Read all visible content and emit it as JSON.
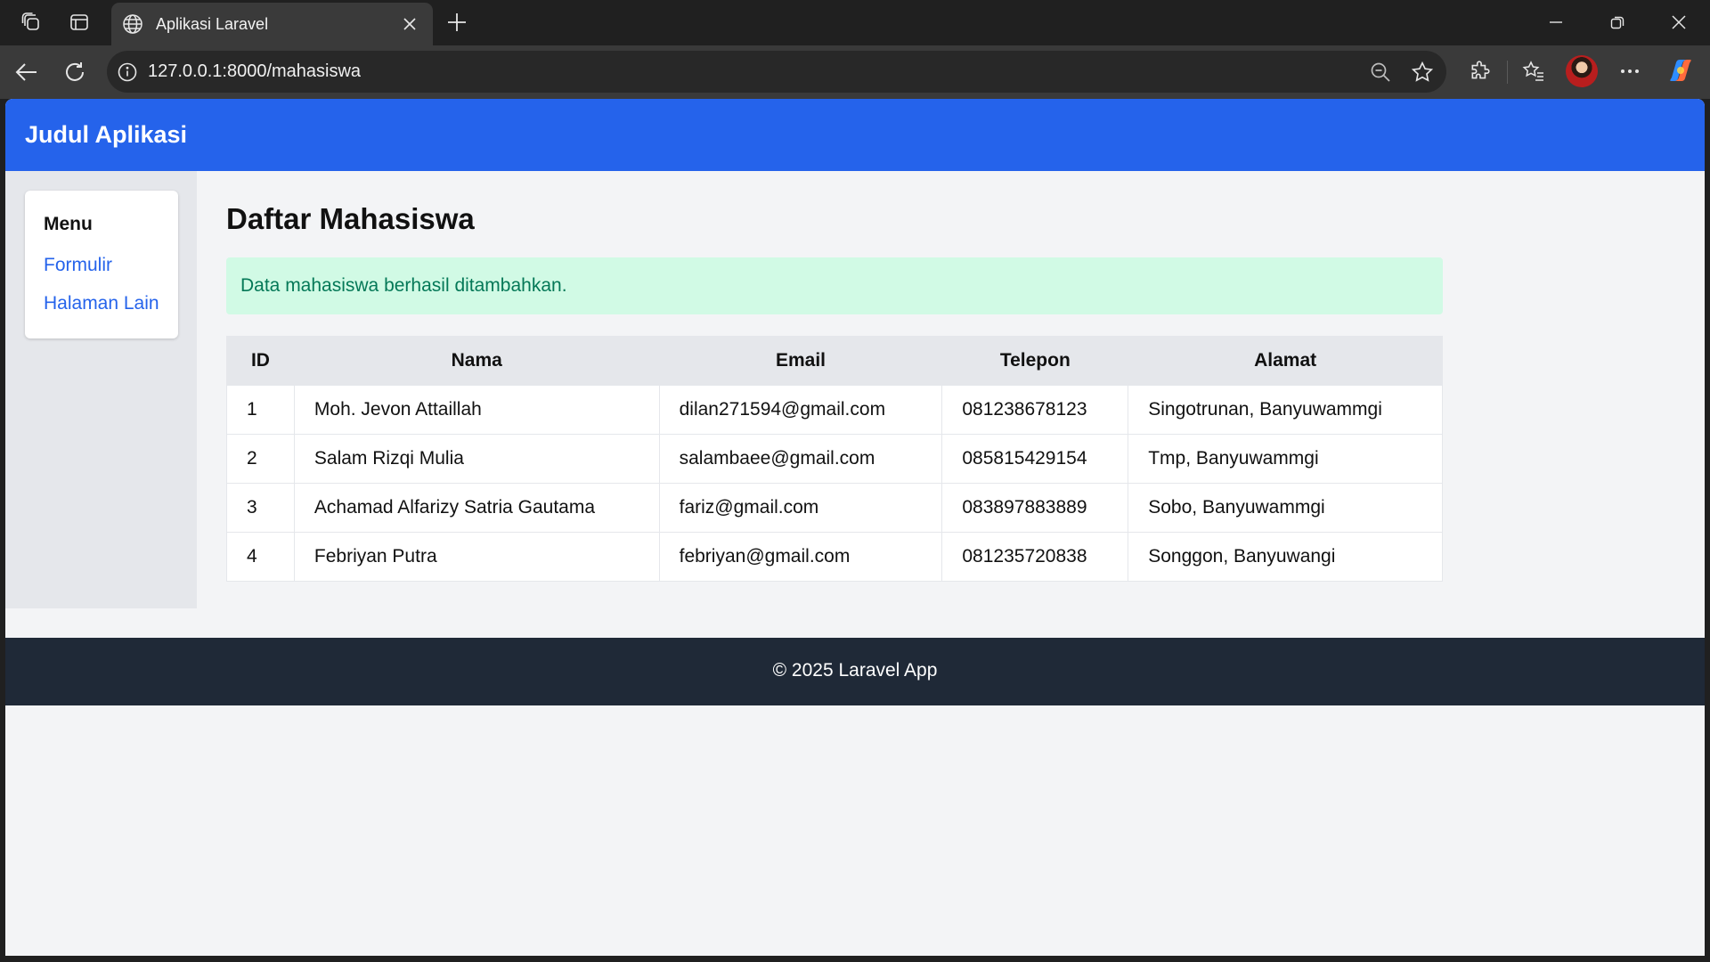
{
  "browser": {
    "tab_title": "Aplikasi Laravel",
    "url": "127.0.0.1:8000/mahasiswa",
    "icons": [
      "workspaces-icon",
      "tab-actions-icon",
      "globe-icon",
      "close-icon",
      "new-tab-icon",
      "minimize-icon",
      "restore-icon",
      "window-close-icon",
      "back-icon",
      "refresh-icon",
      "site-info-icon",
      "zoom-icon",
      "favorite-star-icon",
      "extensions-icon",
      "favorites-icon",
      "profile-avatar",
      "more-icon",
      "copilot-icon"
    ]
  },
  "app": {
    "title": "Judul Aplikasi",
    "brand_color": "#2563eb"
  },
  "sidebar": {
    "heading": "Menu",
    "links": [
      {
        "label": "Formulir"
      },
      {
        "label": "Halaman Lain"
      }
    ]
  },
  "main": {
    "page_title": "Daftar Mahasiswa",
    "alert": "Data mahasiswa berhasil ditambahkan.",
    "table": {
      "headers": [
        "ID",
        "Nama",
        "Email",
        "Telepon",
        "Alamat"
      ],
      "rows": [
        [
          "1",
          "Moh. Jevon Attaillah",
          "dilan271594@gmail.com",
          "081238678123",
          "Singotrunan, Banyuwammgi"
        ],
        [
          "2",
          "Salam Rizqi Mulia",
          "salambaee@gmail.com",
          "085815429154",
          "Tmp, Banyuwammgi"
        ],
        [
          "3",
          "Achamad Alfarizy Satria Gautama",
          "fariz@gmail.com",
          "083897883889",
          "Sobo, Banyuwammgi"
        ],
        [
          "4",
          "Febriyan Putra",
          "febriyan@gmail.com",
          "081235720838",
          "Songgon, Banyuwangi"
        ]
      ]
    }
  },
  "footer": {
    "text": "© 2025 Laravel App"
  }
}
